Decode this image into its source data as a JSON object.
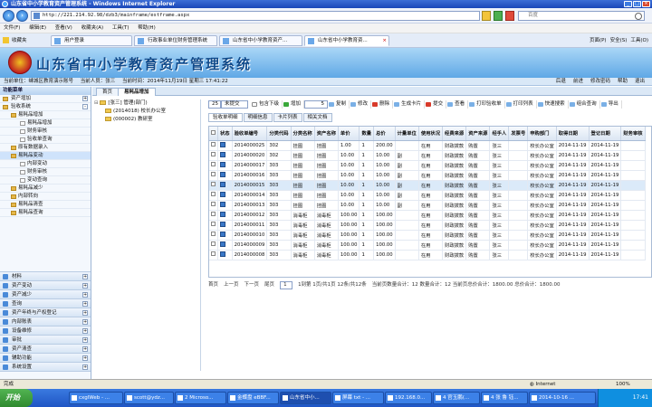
{
  "window": {
    "title": "山东省中小学教育资产管理系统 - Windows Internet Explorer"
  },
  "address": {
    "url": "http://221.214.92.98/dzb3/mainframe/estframe.aspx",
    "search_placeholder": "百度"
  },
  "menu": [
    "文件(F)",
    "编辑(E)",
    "查看(V)",
    "收藏夹(A)",
    "工具(T)",
    "帮助(H)"
  ],
  "favorites": {
    "label": "收藏夹"
  },
  "browser_tabs": [
    {
      "label": "用户登录"
    },
    {
      "label": "行政事业单位财务管理系统"
    },
    {
      "label": "山东省中小学教育资产..."
    },
    {
      "label": "山东省中小学教育资..."
    }
  ],
  "commands": [
    "页面(P)",
    "安全(S)",
    "工具(O)"
  ],
  "banner": {
    "system_name": "山东省中小学教育资产管理系统"
  },
  "status_line": {
    "unit": "当前单位：嵊城区教育演示账号",
    "user": "当前人员：张三",
    "time": "当前时间：2014年11月19日 星期三 17:41:22"
  },
  "top_links": [
    "后退",
    "前进",
    "修改密码",
    "帮助",
    "退出"
  ],
  "sidebar": {
    "header": "功能菜单",
    "top_items": [
      {
        "label": "资产增加",
        "expander": "+"
      },
      {
        "label": "验收系统",
        "expander": "-"
      }
    ],
    "tree": [
      {
        "label": "易耗品增加",
        "level": 1
      },
      {
        "label": "易耗品增加",
        "level": 2
      },
      {
        "label": "财务审核",
        "level": 2
      },
      {
        "label": "验收单查询",
        "level": 2
      },
      {
        "label": "原有数据录入",
        "level": 1
      },
      {
        "label": "易耗品变动",
        "level": 1
      },
      {
        "label": "内部变动",
        "level": 2
      },
      {
        "label": "财务审核",
        "level": 2
      },
      {
        "label": "变动查询",
        "level": 2
      },
      {
        "label": "易耗品减少",
        "level": 1
      },
      {
        "label": "内部转向",
        "level": 1
      },
      {
        "label": "易耗品清查",
        "level": 1
      },
      {
        "label": "易耗品查询",
        "level": 1
      }
    ],
    "groups": [
      {
        "label": "材料"
      },
      {
        "label": "资产变动"
      },
      {
        "label": "资产减少"
      },
      {
        "label": "查询"
      },
      {
        "label": "资产年终与产权登记"
      },
      {
        "label": "内部账表"
      },
      {
        "label": "设备维修"
      },
      {
        "label": "审批"
      },
      {
        "label": "资产清查"
      },
      {
        "label": "辅助功能"
      },
      {
        "label": "系统设置"
      }
    ]
  },
  "main_tabs": [
    {
      "label": "首页"
    },
    {
      "label": "易耗品增加"
    }
  ],
  "org_tree": [
    {
      "label": "[张三] 管理(部门)"
    },
    {
      "label": "(2014018) 校长办公室"
    },
    {
      "label": "(000002) 教研室"
    }
  ],
  "toolbar": {
    "page_size": "25",
    "status_filter": "未提交",
    "include_sub": "包含下级",
    "buttons": [
      "增加",
      "复制",
      "修改",
      "删除",
      "生成卡片",
      "提交",
      "查看",
      "打印验收单",
      "打印列表",
      "快速搜索",
      "组合查询",
      "导出"
    ],
    "copy_count": "5"
  },
  "sub_tabs": [
    {
      "label": "验收单明细"
    },
    {
      "label": "明细信息"
    },
    {
      "label": "卡片列表"
    },
    {
      "label": "相关文档"
    }
  ],
  "grid": {
    "columns": [
      "状态",
      "验收单编号",
      "分类代码",
      "分类名称",
      "资产名称",
      "单价",
      "数量",
      "总价",
      "计量单位",
      "使用状况",
      "经费来源",
      "资产来源",
      "经手人",
      "发票号",
      "申购部门",
      "取得日期",
      "登记日期",
      "财务审核"
    ],
    "rows": [
      [
        "2014000025",
        "302",
        "挂图",
        "挂图",
        "1.00",
        "1",
        "200.00",
        "",
        "在用",
        "财政拨款",
        "购置",
        "张三",
        "",
        "校长办公室",
        "2014-11-19",
        "2014-11-19"
      ],
      [
        "2014000020",
        "302",
        "挂图",
        "挂图",
        "10.00",
        "1",
        "10.00",
        "副",
        "在用",
        "财政拨款",
        "购置",
        "张三",
        "",
        "校长办公室",
        "2014-11-19",
        "2014-11-19"
      ],
      [
        "2014000017",
        "303",
        "挂图",
        "挂图",
        "10.00",
        "1",
        "10.00",
        "副",
        "在用",
        "财政拨款",
        "购置",
        "张三",
        "",
        "校长办公室",
        "2014-11-19",
        "2014-11-19"
      ],
      [
        "2014000016",
        "303",
        "挂图",
        "挂图",
        "10.00",
        "1",
        "10.00",
        "副",
        "在用",
        "财政拨款",
        "购置",
        "张三",
        "",
        "校长办公室",
        "2014-11-19",
        "2014-11-19"
      ],
      [
        "2014000015",
        "303",
        "挂图",
        "挂图",
        "10.00",
        "1",
        "10.00",
        "副",
        "在用",
        "财政拨款",
        "购置",
        "张三",
        "",
        "校长办公室",
        "2014-11-19",
        "2014-11-19"
      ],
      [
        "2014000014",
        "303",
        "挂图",
        "挂图",
        "10.00",
        "1",
        "10.00",
        "副",
        "在用",
        "财政拨款",
        "购置",
        "张三",
        "",
        "校长办公室",
        "2014-11-19",
        "2014-11-19"
      ],
      [
        "2014000013",
        "303",
        "挂图",
        "挂图",
        "10.00",
        "1",
        "10.00",
        "副",
        "在用",
        "财政拨款",
        "购置",
        "张三",
        "",
        "校长办公室",
        "2014-11-19",
        "2014-11-19"
      ],
      [
        "2014000012",
        "303",
        "消毒柜",
        "消毒柜",
        "100.00",
        "1",
        "100.00",
        "",
        "在用",
        "财政拨款",
        "购置",
        "张三",
        "",
        "校长办公室",
        "2014-11-19",
        "2014-11-19"
      ],
      [
        "2014000011",
        "303",
        "消毒柜",
        "消毒柜",
        "100.00",
        "1",
        "100.00",
        "",
        "在用",
        "财政拨款",
        "购置",
        "张三",
        "",
        "校长办公室",
        "2014-11-19",
        "2014-11-19"
      ],
      [
        "2014000010",
        "303",
        "消毒柜",
        "消毒柜",
        "100.00",
        "1",
        "100.00",
        "",
        "在用",
        "财政拨款",
        "购置",
        "张三",
        "",
        "校长办公室",
        "2014-11-19",
        "2014-11-19"
      ],
      [
        "2014000009",
        "303",
        "消毒柜",
        "消毒柜",
        "100.00",
        "1",
        "100.00",
        "",
        "在用",
        "财政拨款",
        "购置",
        "张三",
        "",
        "校长办公室",
        "2014-11-19",
        "2014-11-19"
      ],
      [
        "2014000008",
        "303",
        "消毒柜",
        "消毒柜",
        "100.00",
        "1",
        "100.00",
        "",
        "在用",
        "财政拨款",
        "购置",
        "张三",
        "",
        "校长办公室",
        "2014-11-19",
        "2014-11-19"
      ]
    ]
  },
  "pager": {
    "first": "首页",
    "prev": "上一页",
    "next": "下一页",
    "last": "尾页",
    "goto": "1",
    "info": "1到第 1页/共1页  12条/共12条",
    "totals": "当前页数量合计：12   数量合计：12   当前页总价合计：1800.00   总价合计：1800.00"
  },
  "ie_status": {
    "left": "完成",
    "zone": "Internet",
    "zoom": "100%"
  },
  "taskbar": {
    "start": "开始",
    "tasks": [
      "cxglWeb - ...",
      "scott@ydz...",
      "2 Microso...",
      "金蝶盘 eBBF...",
      "山东省中小...",
      "屏幕 txt - ...",
      "192.168.0...",
      "4 官玉鹏(...",
      "4 张 鲁 钰...",
      "2014-10-16 ..."
    ],
    "clock": "17:41"
  }
}
